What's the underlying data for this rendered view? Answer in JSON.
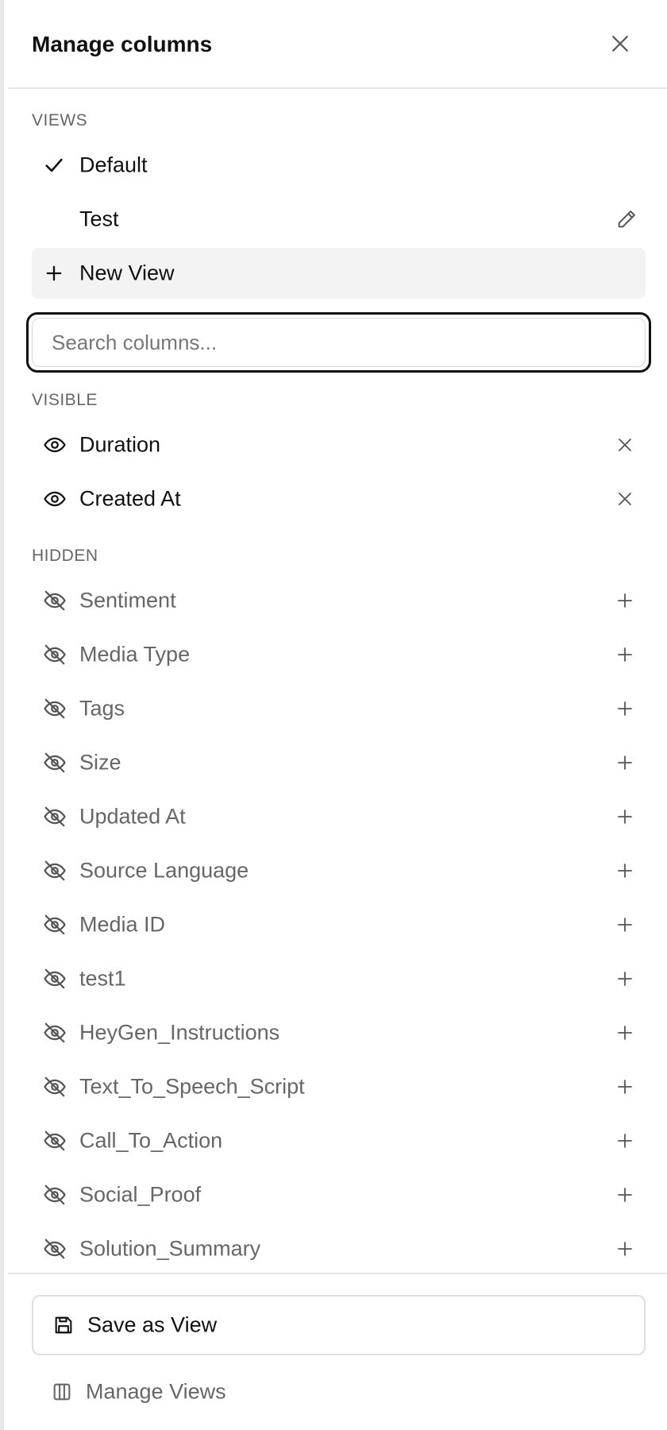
{
  "header": {
    "title": "Manage columns",
    "close_icon": "close-icon"
  },
  "views": {
    "section_label": "VIEWS",
    "items": [
      {
        "label": "Default",
        "selected": true,
        "icon": "check-icon"
      },
      {
        "label": "Test",
        "selected": false,
        "icon": "pencil-icon"
      }
    ],
    "new_view_label": "New View"
  },
  "search": {
    "placeholder": "Search columns...",
    "value": ""
  },
  "visible": {
    "section_label": "VISIBLE",
    "items": [
      "Duration",
      "Created At"
    ]
  },
  "hidden": {
    "section_label": "HIDDEN",
    "items": [
      "Sentiment",
      "Media Type",
      "Tags",
      "Size",
      "Updated At",
      "Source Language",
      "Media ID",
      "test1",
      "HeyGen_Instructions",
      "Text_To_Speech_Script",
      "Call_To_Action",
      "Social_Proof",
      "Solution_Summary"
    ]
  },
  "footer": {
    "save_label": "Save as View",
    "manage_label": "Manage Views"
  },
  "colors": {
    "text": "#111111",
    "muted": "#666666",
    "border": "#e5e5e5",
    "new_view_bg": "#f3f3f3",
    "focus": "#111111"
  }
}
